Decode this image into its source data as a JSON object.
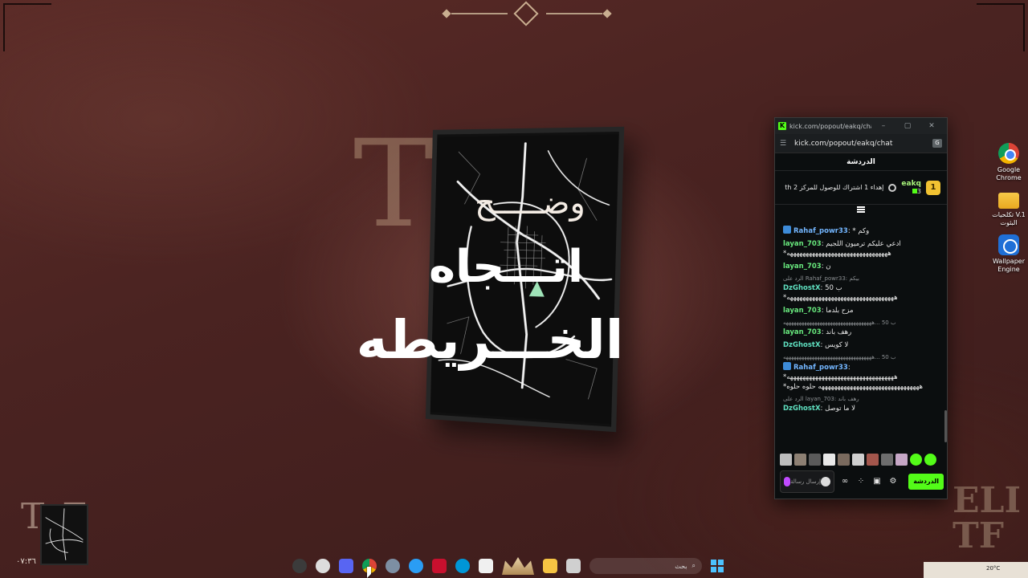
{
  "wallpaper": {
    "hero_line1": "وضـــــح",
    "hero_line2": "اتـــجاه",
    "hero_line3": "الخـــريطه",
    "big_letters": "TF",
    "thumb_letters": "TF",
    "thumb_time": "٠٧:٣٦",
    "logo_line1": "ELI",
    "logo_line2": "TF"
  },
  "desktop_icons": [
    {
      "label": "Google Chrome",
      "icon": "chrome-icon"
    },
    {
      "label": "تكلحيات V.1 البثوت",
      "icon": "folder-icon"
    },
    {
      "label": "Wallpaper Engine",
      "icon": "wallpaper-engine-icon"
    }
  ],
  "popout": {
    "tab_title": "kick.com/popout/eakq/chat...",
    "url": "kick.com/popout/eakq/chat",
    "chat_title": "الدردشة",
    "pinned": {
      "username": "eakq",
      "count": "3",
      "rank": "1",
      "message": "إهداء 1 اشتراك للوصول للمركز 2 th"
    },
    "messages": [
      {
        "user": "Rahaf_powr33",
        "text": "* وكم",
        "reply": ""
      },
      {
        "user": "layan_703",
        "text": "ادعي عليكم ترميون اللجيم",
        "text2": "*ههههههههههههههههههههههههههههههههه",
        "reply": ""
      },
      {
        "user": "layan_703",
        "text": "ن",
        "reply": ""
      },
      {
        "user": "DzGhostX",
        "text": "ب 50",
        "text2": "*ههههههههههههههههههههههههههههههههههه",
        "reply": "الرد على Rahaf_powr33: بيكم"
      },
      {
        "user": "layan_703",
        "text": "مزح بلدما",
        "reply": ""
      },
      {
        "user": "layan_703",
        "text": "رهف باند",
        "reply": "ب 50 ...ههههههههههههههههههههههههههههههههههه"
      },
      {
        "user": "DzGhostX",
        "text": "لا كويس",
        "reply": ""
      },
      {
        "user": "Rahaf_powr33",
        "text": "",
        "text2": "*ههههههههههههههههههههههههههههههههههه",
        "text3": "*ههههههههههههههههههههههههههههههههه حلوه حلوه",
        "reply": "ب 50 ...ههههههههههههههههههههههههههههههههههه"
      },
      {
        "user": "DzGhostX",
        "text": "لا ما توصل",
        "reply": "الرد على layan_703: رهف باند"
      }
    ],
    "input_placeholder": "إرسال رسالة",
    "send_label": "الدردشة"
  },
  "taskbar": {
    "search_placeholder": "بحث"
  },
  "tray": {
    "temp": "20°C"
  }
}
